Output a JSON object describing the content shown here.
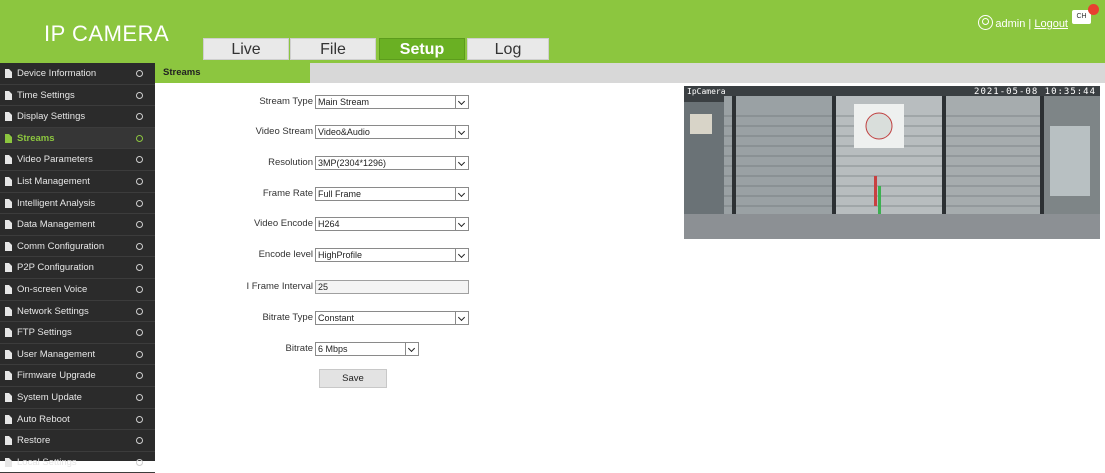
{
  "app": {
    "logo": "IP CAMERA"
  },
  "nav": {
    "tabs": [
      {
        "label": "Live"
      },
      {
        "label": "File"
      },
      {
        "label": "Setup",
        "active": true
      },
      {
        "label": "Log"
      }
    ]
  },
  "user": {
    "name": "admin",
    "separator": "|",
    "logout": "Logout",
    "language": "CH"
  },
  "sidebar": {
    "items": [
      {
        "label": "Device Information"
      },
      {
        "label": "Time Settings"
      },
      {
        "label": "Display Settings"
      },
      {
        "label": "Streams",
        "active": true
      },
      {
        "label": "Video Parameters"
      },
      {
        "label": "List Management"
      },
      {
        "label": "Intelligent Analysis"
      },
      {
        "label": "Data Management"
      },
      {
        "label": "Comm Configuration"
      },
      {
        "label": "P2P Configuration"
      },
      {
        "label": "On-screen Voice"
      },
      {
        "label": "Network Settings"
      },
      {
        "label": "FTP Settings"
      },
      {
        "label": "User Management"
      },
      {
        "label": "Firmware Upgrade"
      },
      {
        "label": "System Update"
      },
      {
        "label": "Auto Reboot"
      },
      {
        "label": "Restore"
      },
      {
        "label": "Local Settings"
      }
    ]
  },
  "page": {
    "title": "Streams"
  },
  "form": {
    "stream_type": {
      "label": "Stream Type",
      "value": "Main Stream"
    },
    "video_stream": {
      "label": "Video Stream",
      "value": "Video&Audio"
    },
    "resolution": {
      "label": "Resolution",
      "value": "3MP(2304*1296)"
    },
    "frame_rate": {
      "label": "Frame Rate",
      "value": "Full Frame"
    },
    "video_encode": {
      "label": "Video Encode",
      "value": "H264"
    },
    "encode_level": {
      "label": "Encode level",
      "value": "HighProfile"
    },
    "i_frame_interval": {
      "label": "I Frame Interval",
      "value": "25"
    },
    "bitrate_type": {
      "label": "Bitrate Type",
      "value": "Constant"
    },
    "bitrate": {
      "label": "Bitrate",
      "value": "6 Mbps"
    },
    "save_label": "Save"
  },
  "preview": {
    "osd_name": "IpCamera",
    "osd_time": "2021-05-08 10:35:44"
  },
  "colors": {
    "brand_green": "#8cc63f",
    "sidebar_bg": "#2b2b2b",
    "active_tab": "#6ab023"
  }
}
